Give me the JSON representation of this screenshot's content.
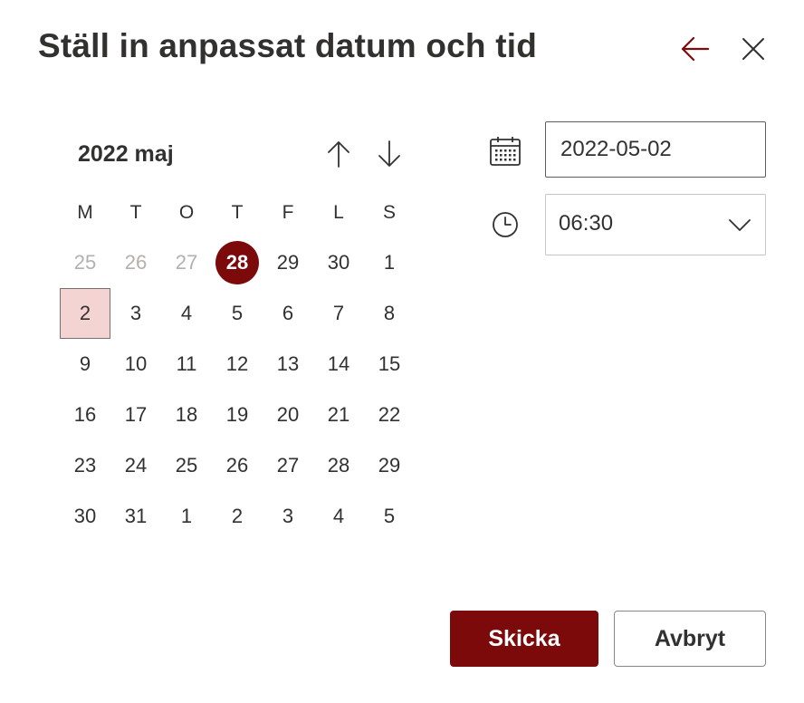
{
  "dialog": {
    "title": "Ställ in anpassat datum och tid"
  },
  "calendar": {
    "month_label": "2022 maj",
    "weekdays": [
      "M",
      "T",
      "O",
      "T",
      "F",
      "L",
      "S"
    ],
    "days": [
      {
        "label": "25",
        "muted": true
      },
      {
        "label": "26",
        "muted": true
      },
      {
        "label": "27",
        "muted": true
      },
      {
        "label": "28",
        "today": true
      },
      {
        "label": "29"
      },
      {
        "label": "30"
      },
      {
        "label": "1"
      },
      {
        "label": "2",
        "selected": true
      },
      {
        "label": "3"
      },
      {
        "label": "4"
      },
      {
        "label": "5"
      },
      {
        "label": "6"
      },
      {
        "label": "7"
      },
      {
        "label": "8"
      },
      {
        "label": "9"
      },
      {
        "label": "10"
      },
      {
        "label": "11"
      },
      {
        "label": "12"
      },
      {
        "label": "13"
      },
      {
        "label": "14"
      },
      {
        "label": "15"
      },
      {
        "label": "16"
      },
      {
        "label": "17"
      },
      {
        "label": "18"
      },
      {
        "label": "19"
      },
      {
        "label": "20"
      },
      {
        "label": "21"
      },
      {
        "label": "22"
      },
      {
        "label": "23"
      },
      {
        "label": "24"
      },
      {
        "label": "25"
      },
      {
        "label": "26"
      },
      {
        "label": "27"
      },
      {
        "label": "28"
      },
      {
        "label": "29"
      },
      {
        "label": "30"
      },
      {
        "label": "31"
      },
      {
        "label": "1"
      },
      {
        "label": "2"
      },
      {
        "label": "3"
      },
      {
        "label": "4"
      },
      {
        "label": "5"
      }
    ]
  },
  "date_field": {
    "value": "2022-05-02",
    "icon": "calendar-icon"
  },
  "time_field": {
    "value": "06:30",
    "icon": "clock-icon"
  },
  "buttons": {
    "submit_label": "Skicka",
    "cancel_label": "Avbryt"
  },
  "colors": {
    "accent": "#7d0a0a",
    "selected_bg": "#f4d3d3",
    "text": "#323130",
    "muted_text": "#b3b0ad"
  }
}
